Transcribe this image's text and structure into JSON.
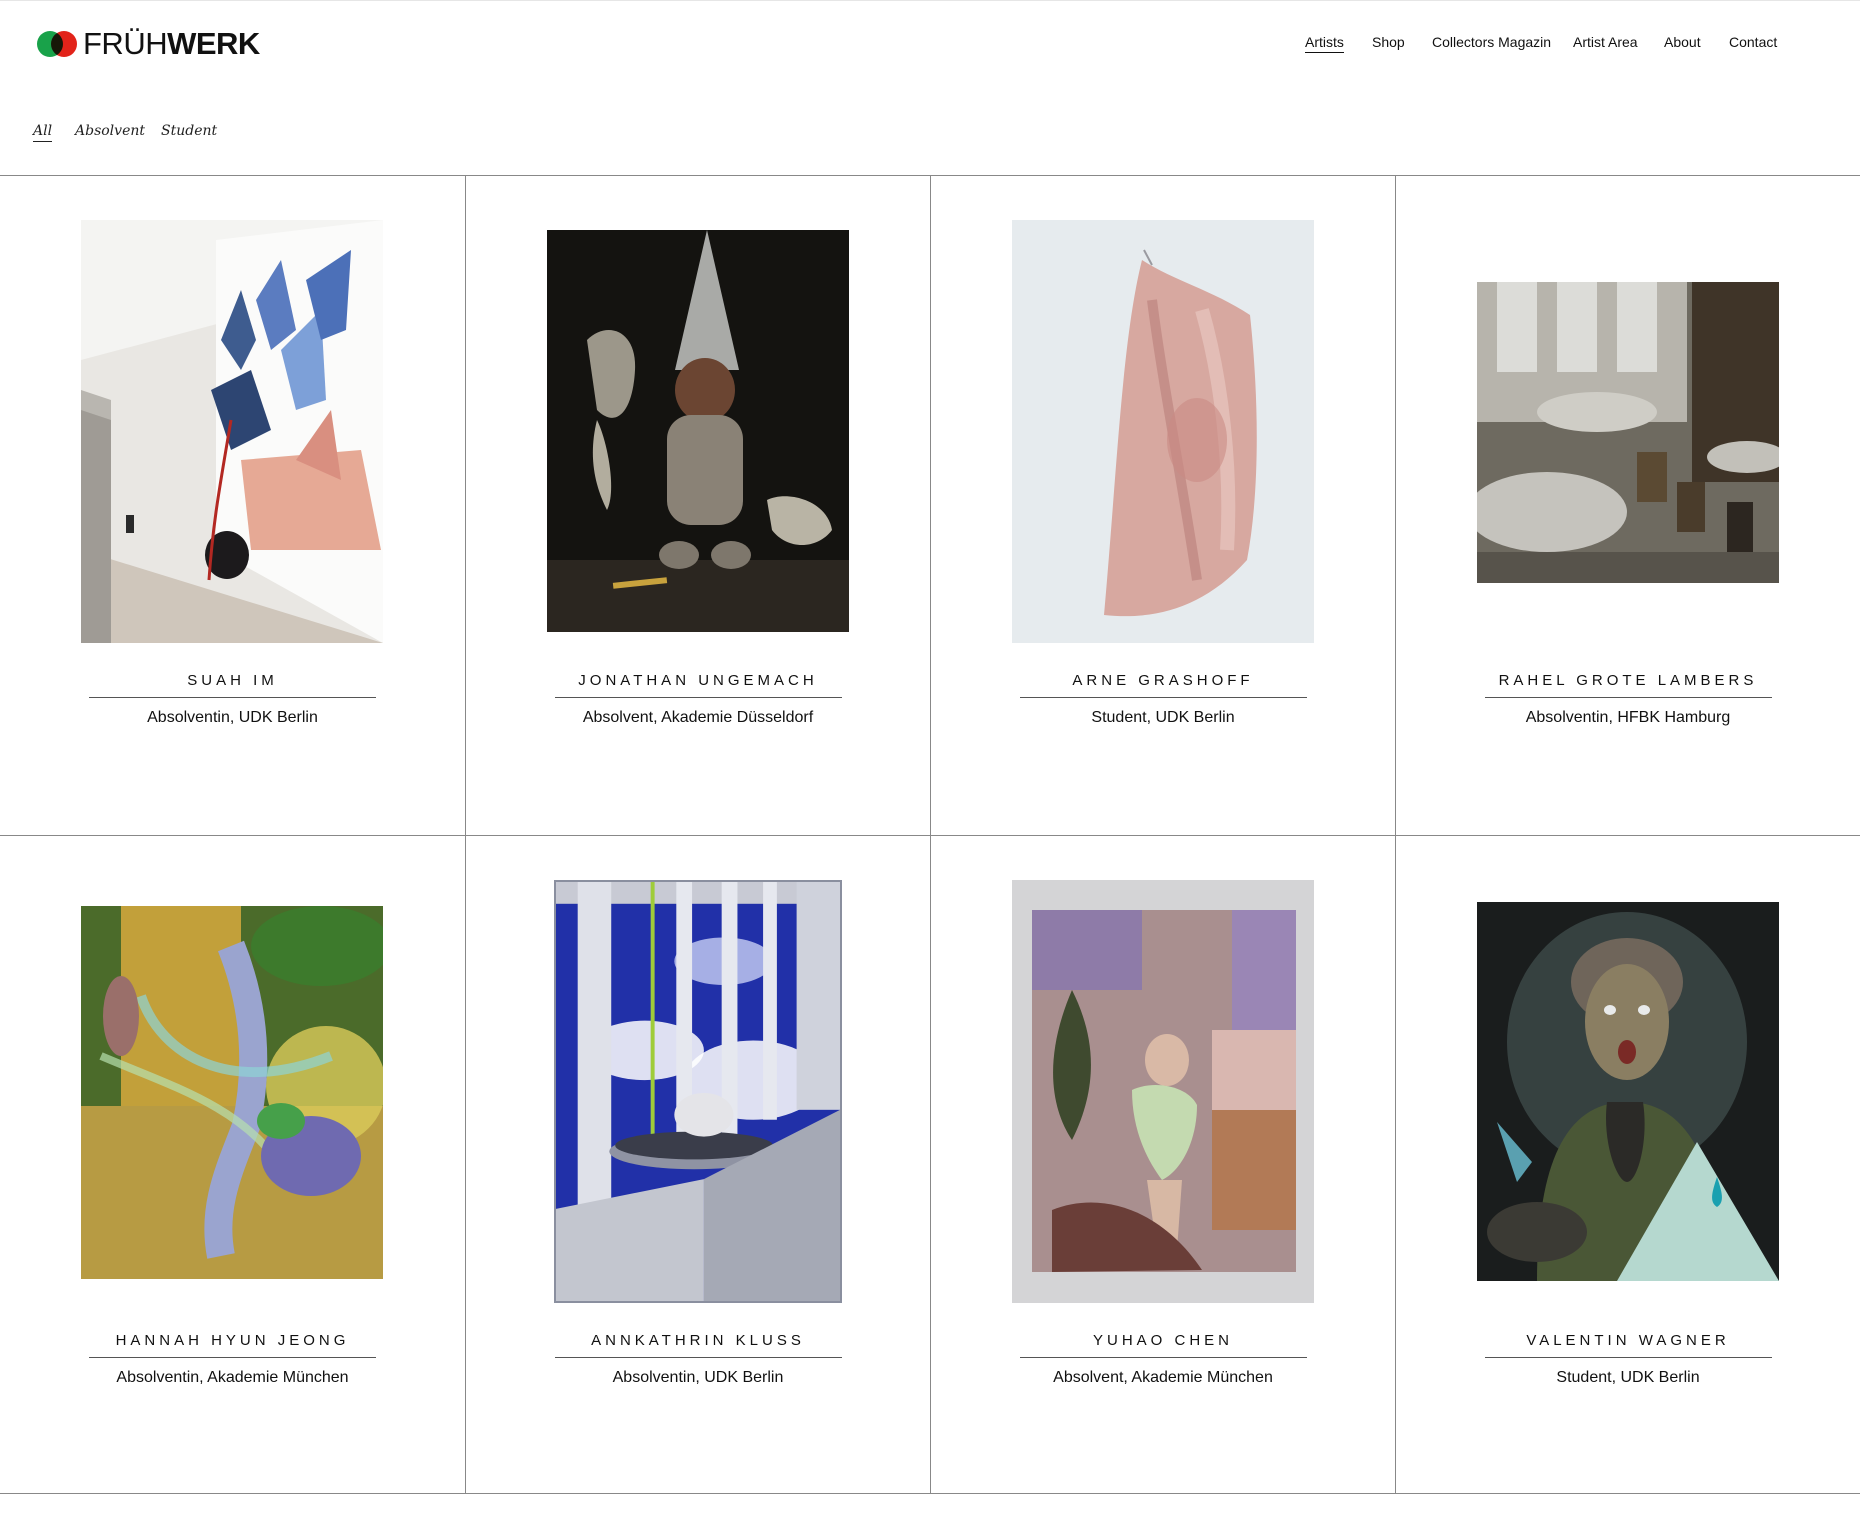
{
  "brand": {
    "logo_light": "FRÜH",
    "logo_bold": "WERK"
  },
  "nav": {
    "items": [
      {
        "label": "Artists",
        "active": true
      },
      {
        "label": "Shop"
      },
      {
        "label": "Collectors Magazin"
      },
      {
        "label": "Artist Area"
      },
      {
        "label": "About"
      },
      {
        "label": "Contact"
      }
    ]
  },
  "filters": {
    "items": [
      {
        "label": "All",
        "active": true
      },
      {
        "label": "Absolvent"
      },
      {
        "label": "Student"
      }
    ]
  },
  "artists": [
    {
      "name": "SUAH IM",
      "info": "Absolventin, UDK Berlin"
    },
    {
      "name": "JONATHAN UNGEMACH",
      "info": "Absolvent, Akademie Düsseldorf"
    },
    {
      "name": "ARNE GRASHOFF",
      "info": "Student, UDK Berlin"
    },
    {
      "name": "RAHEL GROTE LAMBERS",
      "info": "Absolventin, HFBK Hamburg"
    },
    {
      "name": "HANNAH HYUN JEONG",
      "info": "Absolventin, Akademie München"
    },
    {
      "name": "ANNKATHRIN KLUSS",
      "info": "Absolventin, UDK Berlin"
    },
    {
      "name": "YUHAO CHEN",
      "info": "Absolvent, Akademie München"
    },
    {
      "name": "VALENTIN WAGNER",
      "info": "Student, UDK Berlin"
    }
  ],
  "colors": {
    "logo_green": "#19a24a",
    "logo_red": "#e2231a",
    "grid_line": "#888888"
  }
}
